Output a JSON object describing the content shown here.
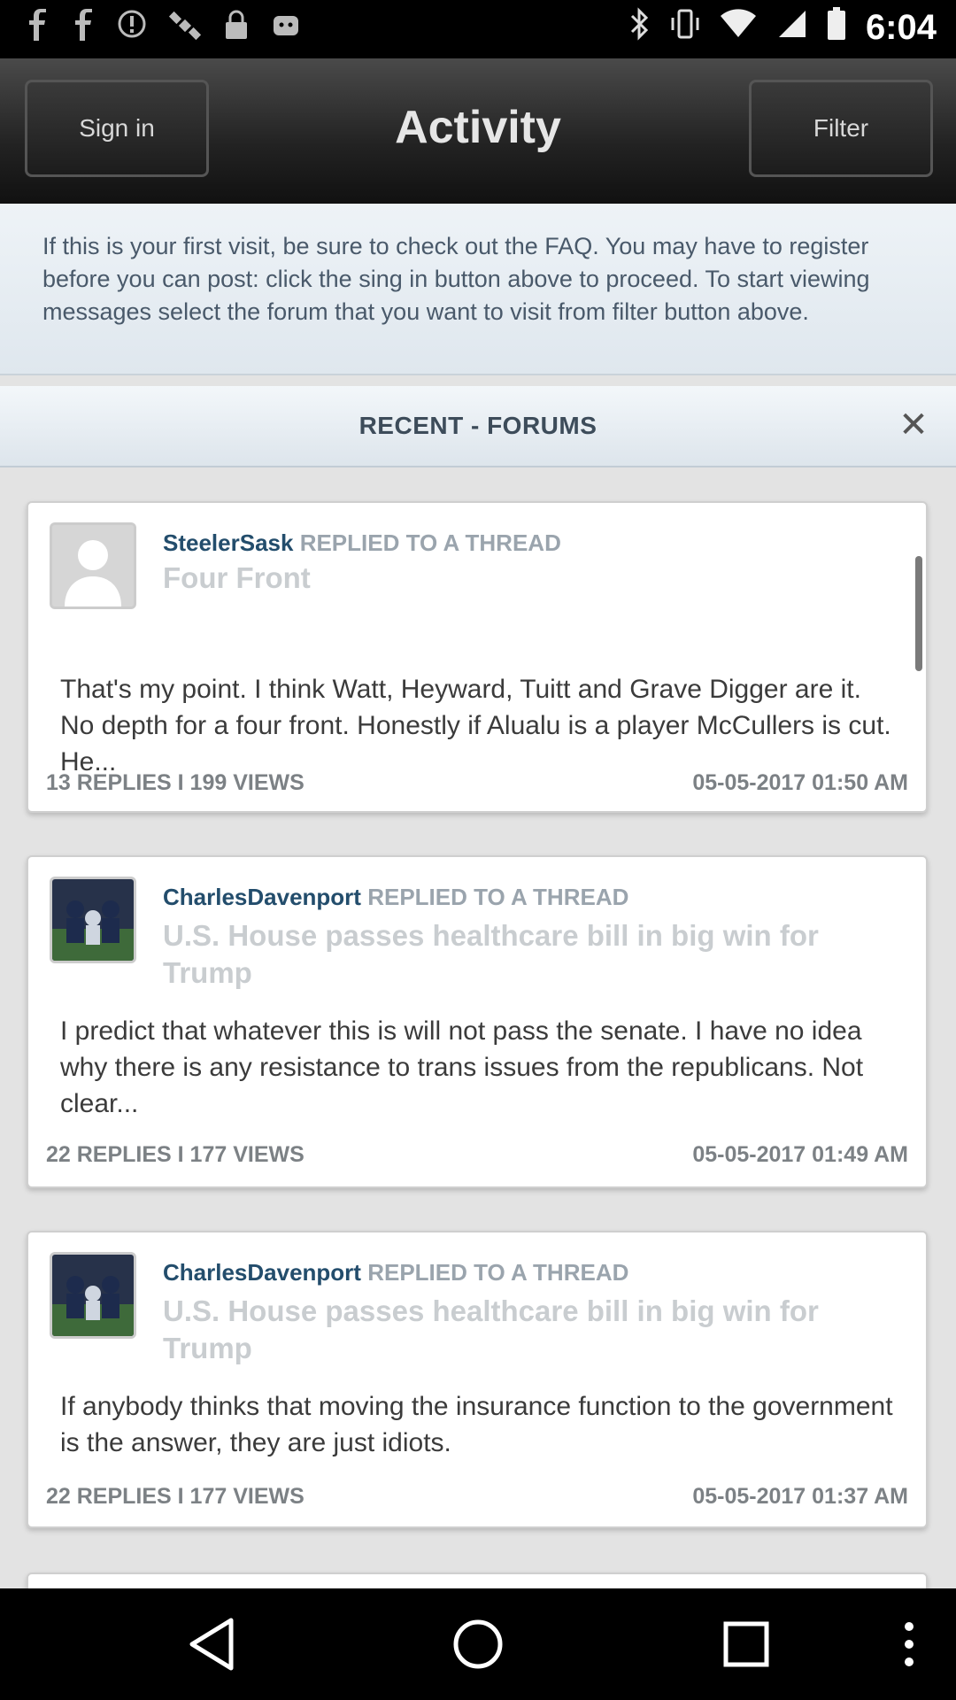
{
  "status_bar": {
    "time": "6:04",
    "icons_left": [
      "facebook-icon",
      "facebook-icon",
      "alert-icon",
      "satellite-icon",
      "lock-icon",
      "android-icon"
    ],
    "icons_right": [
      "bluetooth-icon",
      "vibrate-icon",
      "wifi-icon",
      "signal-icon",
      "battery-icon"
    ]
  },
  "app_bar": {
    "title": "Activity",
    "sign_in_label": "Sign in",
    "filter_label": "Filter"
  },
  "notice": {
    "text": "If this is your first visit, be sure to check out the FAQ. You may have to register before you can post: click the sing in button above to proceed. To start viewing messages select the forum that you want to visit from filter button above."
  },
  "recent": {
    "label": "RECENT - FORUMS",
    "close_icon": "close-icon"
  },
  "cards": [
    {
      "user": "SteelerSask",
      "action": "REPLIED TO A THREAD",
      "thread": "Four Front",
      "body": "That's my point. I think Watt, Heyward, Tuitt and Grave Digger are it. No depth for a four front. Honestly if Alualu is a player McCullers is cut. He...",
      "stats": "13 REPLIES I 199 VIEWS",
      "date": "05-05-2017 01:50 AM"
    },
    {
      "user": "CharlesDavenport",
      "action": "REPLIED TO A THREAD",
      "thread": "U.S. House passes healthcare bill in big win for Trump",
      "body": "I predict that whatever this is will not pass the senate. I have no idea why there is any resistance to trans issues from the republicans. Not clear...",
      "stats": "22 REPLIES I 177 VIEWS",
      "date": "05-05-2017 01:49 AM"
    },
    {
      "user": "CharlesDavenport",
      "action": "REPLIED TO A THREAD",
      "thread": "U.S. House passes healthcare bill in big win for Trump",
      "body": "If anybody thinks that moving the insurance function to the government is the answer, they are just idiots.",
      "stats": "22 REPLIES I 177 VIEWS",
      "date": "05-05-2017 01:37 AM"
    }
  ],
  "nav_bar": {
    "icons": [
      "back-icon",
      "home-icon",
      "recents-icon",
      "menu-icon"
    ]
  }
}
